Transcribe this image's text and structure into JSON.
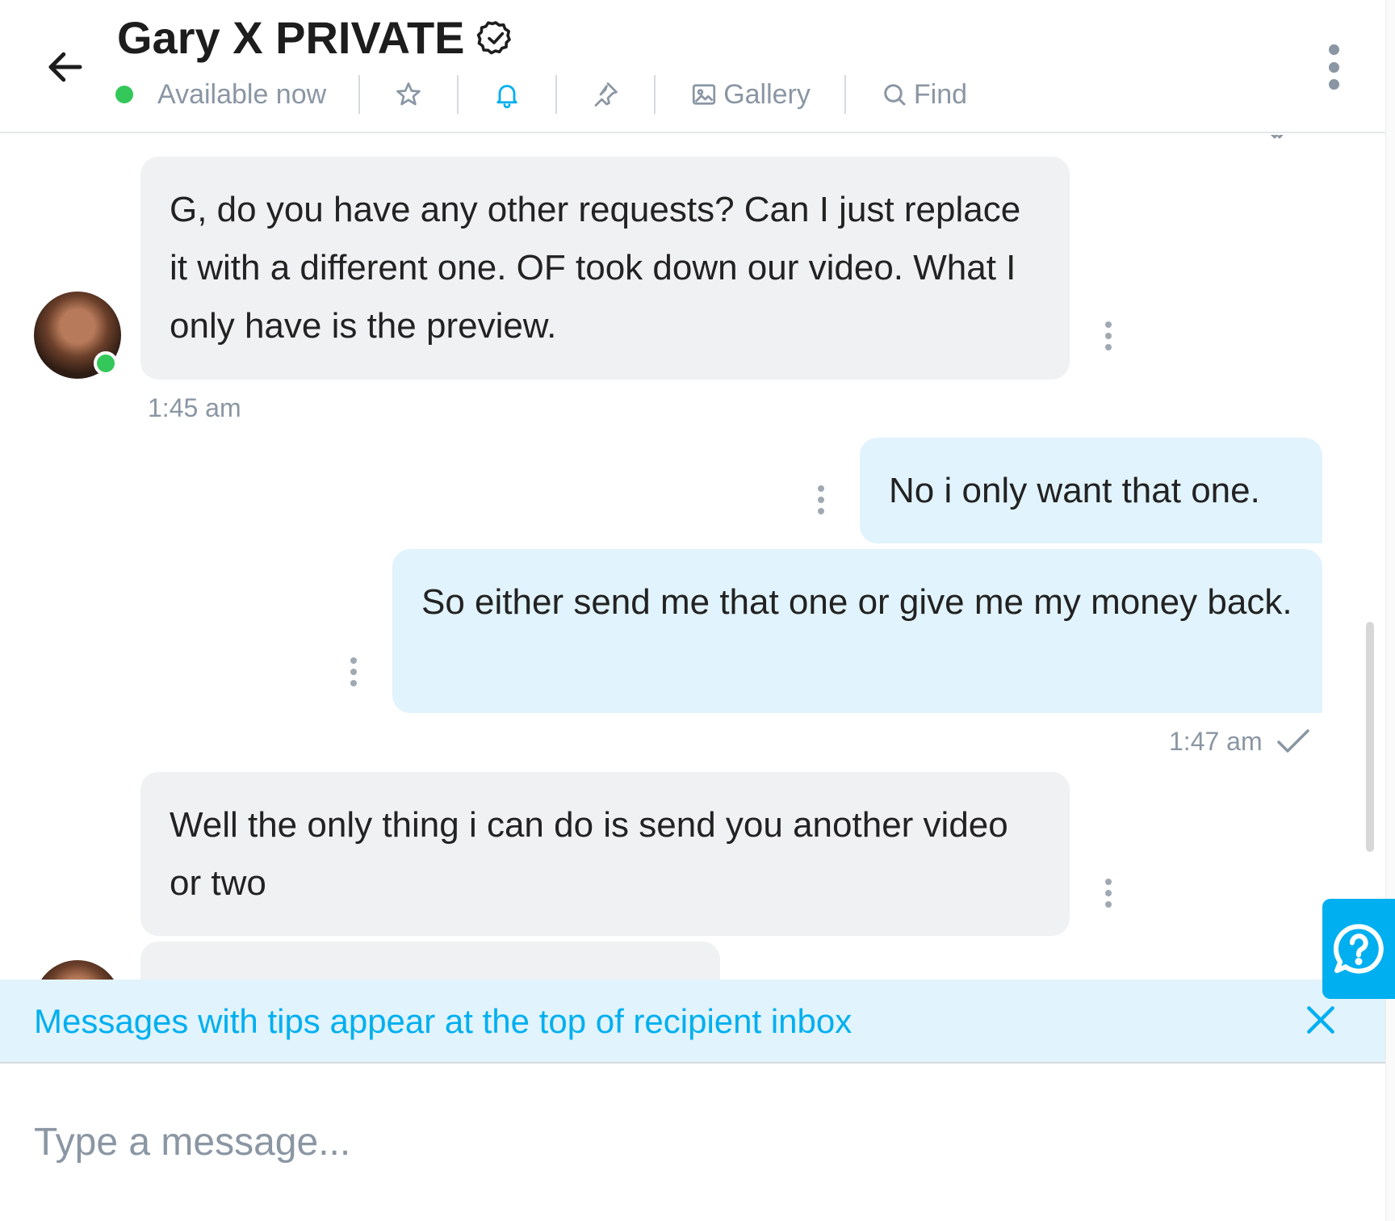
{
  "header": {
    "back_icon": "arrow-left-icon",
    "title": "Gary X PRIVATE",
    "verified_icon": "verified-badge-icon",
    "status": "Available now",
    "toolbar": {
      "favorite_icon": "star-icon",
      "notify_icon": "bell-icon",
      "pin_icon": "pin-icon",
      "gallery_label": "Gallery",
      "find_label": "Find"
    },
    "more_icon": "more-vertical-icon"
  },
  "colors": {
    "accent": "#00aff0",
    "online": "#34c759",
    "incoming_bubble": "#f0f1f3",
    "outgoing_bubble": "#e1f3fc",
    "muted_text": "#8a96a3"
  },
  "messages": [
    {
      "direction": "in",
      "text": "G, do you have any other requests? Can I just replace it with a different one. OF took down our video. What I only have is the preview.",
      "time": "1:45 am"
    },
    {
      "direction": "out",
      "text": "No i only want that one."
    },
    {
      "direction": "out",
      "text": "So either send me that one or give me my money back.",
      "time": "1:47 am"
    },
    {
      "direction": "in",
      "text": "Well the only thing i can do is send you another video or two"
    }
  ],
  "tip_banner": {
    "text": "Messages with tips appear at the top of recipient inbox",
    "close_icon": "close-icon"
  },
  "help_icon": "help-question-icon",
  "composer": {
    "placeholder": "Type a message..."
  }
}
